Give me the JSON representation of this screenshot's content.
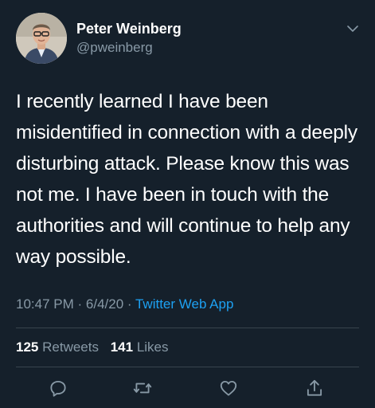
{
  "tweet": {
    "author": {
      "name": "Peter Weinberg",
      "handle": "@pweinberg"
    },
    "text": "I recently learned I have been misidentified in connection with a deeply disturbing attack. Please know this was not me. I have been in touch with the authorities and will continue to help any way possible.",
    "time": "10:47 PM",
    "date": "6/4/20",
    "source": "Twitter Web App",
    "retweets_count": "125",
    "retweets_label": "Retweets",
    "likes_count": "141",
    "likes_label": "Likes"
  },
  "actions": [
    {
      "icon": "reply-icon"
    },
    {
      "icon": "retweet-icon"
    },
    {
      "icon": "like-icon"
    },
    {
      "icon": "share-icon"
    }
  ],
  "colors": {
    "background": "#15202b",
    "secondary_text": "#8899a6",
    "link": "#1da1f2",
    "divider": "#38444d"
  }
}
